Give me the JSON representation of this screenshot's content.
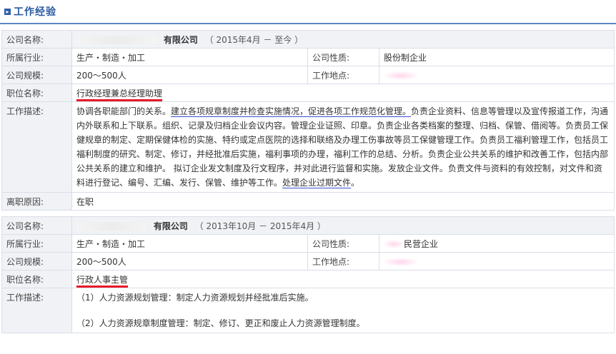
{
  "section": {
    "title": "工作经验",
    "icon": "arrow-right-icon"
  },
  "jobs": [
    {
      "company_label": "公司名称:",
      "company_suffix": "有限公司",
      "period": "（ 2015年4月 － 至今 ）",
      "industry_label": "所属行业:",
      "industry": "生产・制造・加工",
      "nature_label": "公司性质:",
      "nature": "股份制企业",
      "size_label": "公司规模:",
      "size": "200～500人",
      "location_label": "工作地点:",
      "location": "",
      "position_label": "职位名称:",
      "position": "行政经理兼总经理助理",
      "desc_label": "工作描述:",
      "desc_parts": [
        "协调各职能部门的关系。",
        "建立各项规章制度并检查实施情况，促进各项工作规范化管理。",
        "负责企业资料、信息等管理以及宣传报道工作，沟通内外联系和上下联系。组织、记录及归档企业会议内容。管理企业证照、印章。负责企业各类档案的整理、归档、保管、借阅等。负责员工保健规章的制定、定期保健体检的实施、特约或定点医院的选择和联络及办理工伤事故等员工保健管理工作。负责员工福利管理工作，包括员工福利制度的研究、制定、修订，并经批准后实施，福利事项的办理，福利工作的总结、分析。负责企业公共关系的维护和改善工作，包括内部公共关系的建立和维护。 拟订企业发文制度及行文程序，并对此进行监督和实施。发放企业文件。负责文件与资料的有效控制，对文件和资料进行登记、编号、汇编、发行、保管、维护等工作。",
        "处理企业过期文件",
        "。"
      ],
      "leave_label": "离职原因:",
      "leave": "在职"
    },
    {
      "company_label": "公司名称:",
      "company_suffix": "有限公司",
      "period": "（ 2013年10月 － 2015年4月 ）",
      "industry_label": "所属行业:",
      "industry": "生产・制造・加工",
      "nature_label": "公司性质:",
      "nature": "民营企业",
      "size_label": "公司规模:",
      "size": "200～500人",
      "location_label": "工作地点:",
      "location": "",
      "position_label": "职位名称:",
      "position": "行政人事主管",
      "desc_label": "工作描述:",
      "desc_lines": [
        "（1）人力资源规划管理：制定人力资源规划并经批准后实施。",
        "（2）人力资源规章制度管理：制定、修订、更正和废止人力资源管理制度。"
      ]
    }
  ]
}
